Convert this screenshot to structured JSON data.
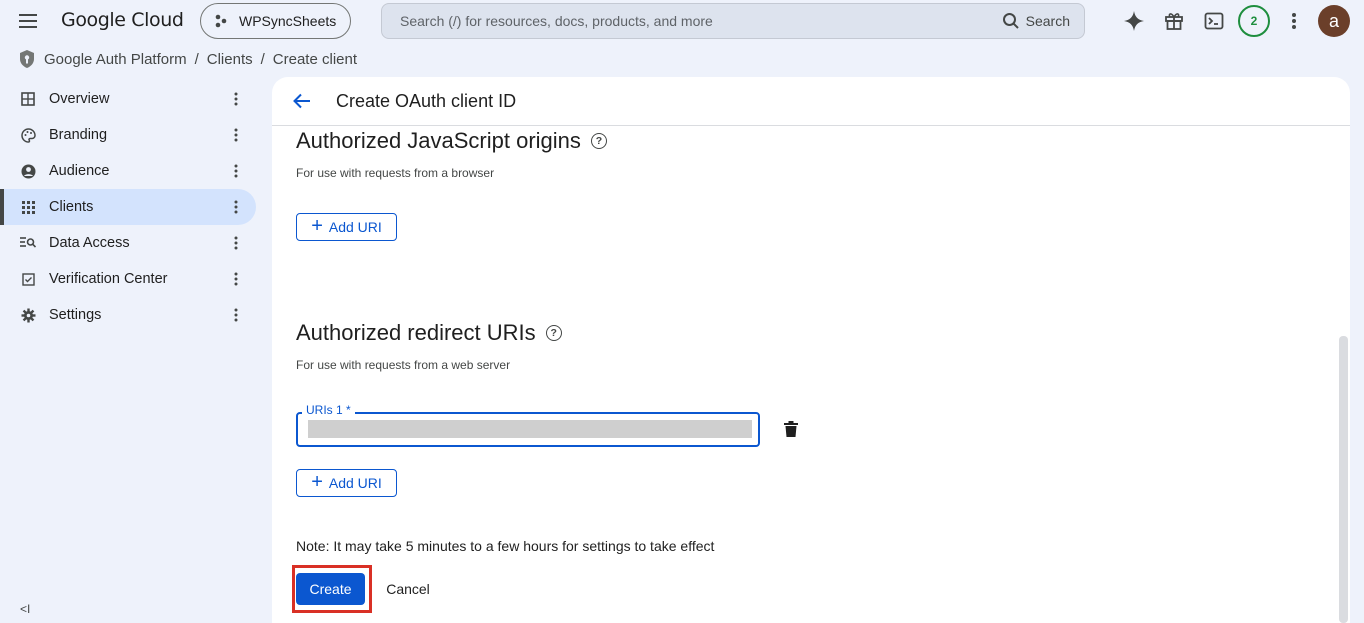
{
  "header": {
    "logo": "Google Cloud",
    "project": "WPSyncSheets",
    "search_placeholder": "Search (/) for resources, docs, products, and more",
    "search_button": "Search",
    "notifications_count": "2",
    "avatar_initial": "a"
  },
  "breadcrumb": {
    "items": [
      "Google Auth Platform",
      "Clients",
      "Create client"
    ],
    "separator": "/"
  },
  "sidebar": {
    "items": [
      {
        "label": "Overview",
        "icon": "dashboard-icon"
      },
      {
        "label": "Branding",
        "icon": "palette-icon"
      },
      {
        "label": "Audience",
        "icon": "account-circle-icon"
      },
      {
        "label": "Clients",
        "icon": "grid-icon",
        "active": true
      },
      {
        "label": "Data Access",
        "icon": "manage-search-icon"
      },
      {
        "label": "Verification Center",
        "icon": "checkbox-icon"
      },
      {
        "label": "Settings",
        "icon": "gear-icon"
      }
    ],
    "collapse_glyph": "<I"
  },
  "main": {
    "title": "Create OAuth client ID",
    "js_origins": {
      "title": "Authorized JavaScript origins",
      "subtitle": "For use with requests from a browser",
      "add_button": "Add URI"
    },
    "redirect_uris": {
      "title": "Authorized redirect URIs",
      "subtitle": "For use with requests from a web server",
      "field_label": "URIs 1 *",
      "field_value": "",
      "add_button": "Add URI"
    },
    "note": "Note: It may take 5 minutes to a few hours for settings to take effect",
    "create_button": "Create",
    "cancel_button": "Cancel"
  },
  "colors": {
    "primary": "#0b57d0",
    "highlight": "#d93025",
    "active_nav": "#d3e3fd",
    "background": "#eef2fb"
  }
}
